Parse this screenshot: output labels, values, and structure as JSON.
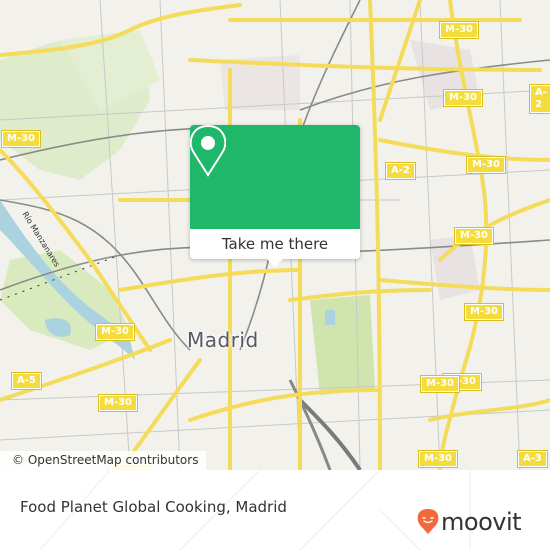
{
  "map": {
    "city_label": "Madrid",
    "river_label": "Río Manzanares",
    "road_shields": [
      {
        "label": "M-30"
      },
      {
        "label": "M-30"
      },
      {
        "label": "A-2"
      },
      {
        "label": "M-30"
      },
      {
        "label": "M-30"
      },
      {
        "label": "M-30"
      },
      {
        "label": "M-30"
      },
      {
        "label": "A-2"
      },
      {
        "label": "M-30"
      },
      {
        "label": "M-30"
      },
      {
        "label": "A-5"
      },
      {
        "label": "M-30"
      },
      {
        "label": "M-30"
      },
      {
        "label": "M-30"
      },
      {
        "label": "A-3"
      },
      {
        "label": "M-30"
      }
    ],
    "attribution": "© OpenStreetMap contributors",
    "colors": {
      "background": "#f2f1ec",
      "park": "#d4e8b8",
      "major_road": "#f6e46a",
      "rail": "#8a8a8a",
      "water": "#aad3df"
    }
  },
  "popup": {
    "button_label": "Take me there",
    "icon": "map-pin-icon",
    "color": "#1fb86a"
  },
  "footer": {
    "place_name": "Food Planet Global Cooking, Madrid",
    "brand": "moovit",
    "brand_color": "#f26a3c"
  }
}
